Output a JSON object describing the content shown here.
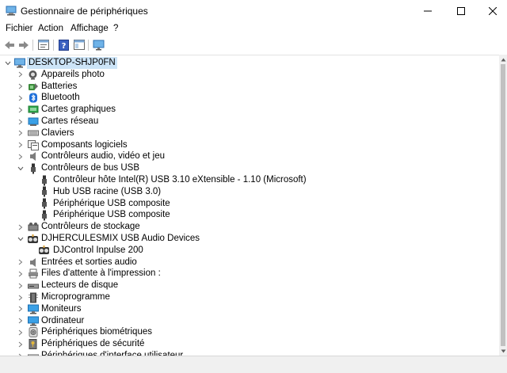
{
  "window": {
    "title": "Gestionnaire de périphériques"
  },
  "menu": [
    "Fichier",
    "Action",
    "Affichage",
    "?"
  ],
  "toolbar": {
    "buttons": [
      "back-arrow-icon",
      "forward-arrow-icon",
      "properties-icon",
      "help-icon",
      "view-icon",
      "monitor-icon"
    ]
  },
  "tree": {
    "root": "DESKTOP-SHJP0FN",
    "items": [
      {
        "label": "Appareils photo",
        "icon": "camera-icon",
        "level": 1,
        "expanded": false
      },
      {
        "label": "Batteries",
        "icon": "battery-icon",
        "level": 1,
        "expanded": false
      },
      {
        "label": "Bluetooth",
        "icon": "bluetooth-icon",
        "level": 1,
        "expanded": false
      },
      {
        "label": "Cartes graphiques",
        "icon": "display-adapter-icon",
        "level": 1,
        "expanded": false
      },
      {
        "label": "Cartes réseau",
        "icon": "network-adapter-icon",
        "level": 1,
        "expanded": false
      },
      {
        "label": "Claviers",
        "icon": "keyboard-icon",
        "level": 1,
        "expanded": false
      },
      {
        "label": "Composants logiciels",
        "icon": "software-component-icon",
        "level": 1,
        "expanded": false
      },
      {
        "label": "Contrôleurs audio, vidéo et jeu",
        "icon": "speaker-icon",
        "level": 1,
        "expanded": false
      },
      {
        "label": "Contrôleurs de bus USB",
        "icon": "usb-icon",
        "level": 1,
        "expanded": true
      },
      {
        "label": "Contrôleur hôte Intel(R) USB 3.10 eXtensible - 1.10 (Microsoft)",
        "icon": "usb-icon",
        "level": 2
      },
      {
        "label": "Hub USB racine (USB 3.0)",
        "icon": "usb-icon",
        "level": 2
      },
      {
        "label": "Périphérique USB composite",
        "icon": "usb-icon",
        "level": 2
      },
      {
        "label": "Périphérique USB composite",
        "icon": "usb-icon",
        "level": 2
      },
      {
        "label": "Contrôleurs de stockage",
        "icon": "storage-controller-icon",
        "level": 1,
        "expanded": false
      },
      {
        "label": "DJHERCULESMIX USB Audio Devices",
        "icon": "dj-device-icon",
        "level": 1,
        "expanded": true
      },
      {
        "label": "DJControl Inpulse 200",
        "icon": "dj-device-icon",
        "level": 2
      },
      {
        "label": "Entrées et sorties audio",
        "icon": "speaker-icon",
        "level": 1,
        "expanded": false
      },
      {
        "label": "Files d'attente à l'impression :",
        "icon": "printer-icon",
        "level": 1,
        "expanded": false
      },
      {
        "label": "Lecteurs de disque",
        "icon": "disk-drive-icon",
        "level": 1,
        "expanded": false
      },
      {
        "label": "Microprogramme",
        "icon": "firmware-icon",
        "level": 1,
        "expanded": false
      },
      {
        "label": "Moniteurs",
        "icon": "monitor-icon",
        "level": 1,
        "expanded": false
      },
      {
        "label": "Ordinateur",
        "icon": "computer-icon",
        "level": 1,
        "expanded": false
      },
      {
        "label": "Périphériques biométriques",
        "icon": "fingerprint-icon",
        "level": 1,
        "expanded": false
      },
      {
        "label": "Périphériques de sécurité",
        "icon": "security-key-icon",
        "level": 1,
        "expanded": false
      },
      {
        "label": "Périphériques d'interface utilisateur",
        "icon": "hid-icon",
        "level": 1,
        "expanded": false
      }
    ]
  },
  "colors": {
    "selection": "#cce4f7",
    "accent": "#0078d7"
  }
}
